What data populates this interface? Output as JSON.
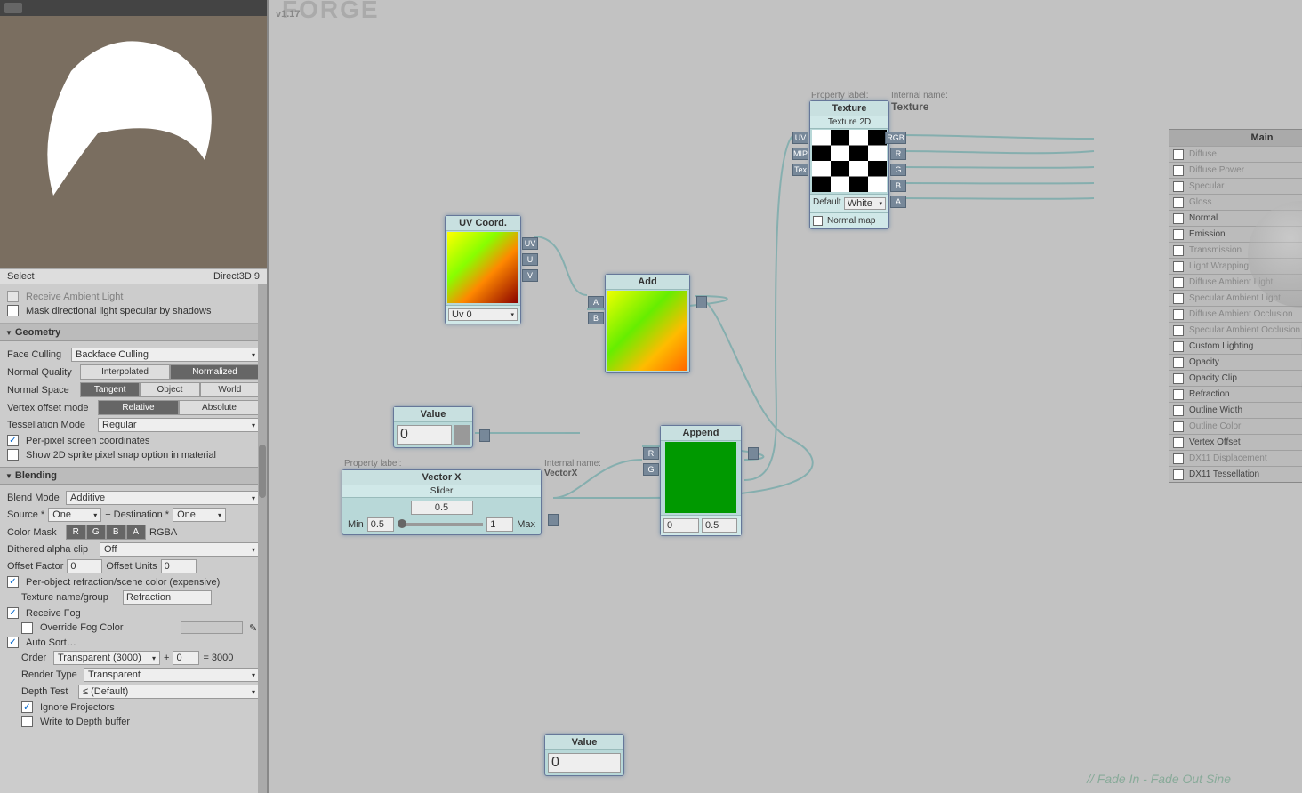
{
  "brand": "FORGE",
  "version": "v1.17",
  "preview": {
    "select": "Select",
    "api": "Direct3D 9"
  },
  "cutoff_row": "Receive Ambient Light",
  "mask_row": "Mask directional light specular by shadows",
  "geometry": {
    "title": "Geometry",
    "face_culling": {
      "label": "Face Culling",
      "value": "Backface Culling"
    },
    "normal_quality": {
      "label": "Normal Quality",
      "a": "Interpolated",
      "b": "Normalized"
    },
    "normal_space": {
      "label": "Normal Space",
      "a": "Tangent",
      "b": "Object",
      "c": "World"
    },
    "vertex_offset": {
      "label": "Vertex offset mode",
      "a": "Relative",
      "b": "Absolute"
    },
    "tess": {
      "label": "Tessellation Mode",
      "value": "Regular"
    },
    "per_pixel": "Per-pixel screen coordinates",
    "show_2d": "Show 2D sprite pixel snap option in material"
  },
  "blending": {
    "title": "Blending",
    "blend_mode": {
      "label": "Blend Mode",
      "value": "Additive"
    },
    "source": {
      "label": "Source *",
      "value": "One"
    },
    "dest": {
      "label": "+ Destination *",
      "value": "One"
    },
    "color_mask": {
      "label": "Color Mask",
      "r": "R",
      "g": "G",
      "b": "B",
      "a": "A",
      "rgba": "RGBA"
    },
    "dithered": {
      "label": "Dithered alpha clip",
      "value": "Off"
    },
    "offset_factor": {
      "label": "Offset Factor",
      "value": "0"
    },
    "offset_units": {
      "label": "Offset Units",
      "value": "0"
    },
    "refraction": "Per-object refraction/scene color (expensive)",
    "tex_name": {
      "label": "Texture name/group",
      "value": "Refraction"
    },
    "fog": "Receive Fog",
    "override_fog": "Override Fog Color",
    "auto_sort": "Auto Sort…",
    "order": {
      "label": "Order",
      "value": "Transparent (3000)",
      "plus": "+",
      "num": "0",
      "eq": "= 3000"
    },
    "render_type": {
      "label": "Render Type",
      "value": "Transparent"
    },
    "depth_test": {
      "label": "Depth Test",
      "value": "≤ (Default)"
    },
    "ignore_proj": "Ignore Projectors",
    "write_depth": "Write to Depth buffer"
  },
  "nodes": {
    "uv": {
      "title": "UV Coord.",
      "dd": "Uv 0",
      "ports": {
        "uv": "UV",
        "u": "U",
        "v": "V"
      }
    },
    "add": {
      "title": "Add",
      "a": "A",
      "b": "B"
    },
    "value1": {
      "title": "Value",
      "val": "0"
    },
    "value2": {
      "title": "Value",
      "val": "0"
    },
    "vectorx": {
      "prop": "Property label:",
      "title": "Vector X",
      "sub": "Slider",
      "val": "0.5",
      "min_l": "Min",
      "min": "0.5",
      "max": "1",
      "max_l": "Max",
      "internal_l": "Internal name:",
      "internal": "VectorX"
    },
    "append": {
      "title": "Append",
      "r": "R",
      "g": "G",
      "out1": "0",
      "out2": "0.5"
    },
    "texture": {
      "prop": "Property label:",
      "title": "Texture",
      "sub": "Texture 2D",
      "internal_l": "Internal name:",
      "internal": "Texture",
      "uv": "UV",
      "mip": "MIP",
      "tex": "Tex",
      "rgb": "RGB",
      "r": "R",
      "g": "G",
      "b": "B",
      "a": "A",
      "def": "Default",
      "white": "White",
      "normal": "Normal map"
    }
  },
  "output": {
    "title": "Main",
    "rows": [
      {
        "l": "Diffuse",
        "dim": true
      },
      {
        "l": "Diffuse Power",
        "dim": true
      },
      {
        "l": "Specular",
        "dim": true
      },
      {
        "l": "Gloss",
        "dim": true
      },
      {
        "l": "Normal",
        "dim": false
      },
      {
        "l": "Emission",
        "dim": false
      },
      {
        "l": "Transmission",
        "dim": true
      },
      {
        "l": "Light Wrapping",
        "dim": true
      },
      {
        "l": "Diffuse Ambient Light",
        "dim": true
      },
      {
        "l": "Specular Ambient Light",
        "dim": true
      },
      {
        "l": "Diffuse Ambient Occlusion",
        "dim": true
      },
      {
        "l": "Specular Ambient Occlusion",
        "dim": true
      },
      {
        "l": "Custom Lighting",
        "dim": false
      },
      {
        "l": "Opacity",
        "dim": false
      },
      {
        "l": "Opacity Clip",
        "dim": false
      },
      {
        "l": "Refraction",
        "dim": false
      },
      {
        "l": "Outline Width",
        "dim": false
      },
      {
        "l": "Outline Color",
        "dim": true
      },
      {
        "l": "Vertex Offset",
        "dim": false
      },
      {
        "l": "DX11 Displacement",
        "dim": true
      },
      {
        "l": "DX11 Tessellation",
        "dim": false
      }
    ]
  },
  "comment": "// Fade In - Fade Out Sine"
}
